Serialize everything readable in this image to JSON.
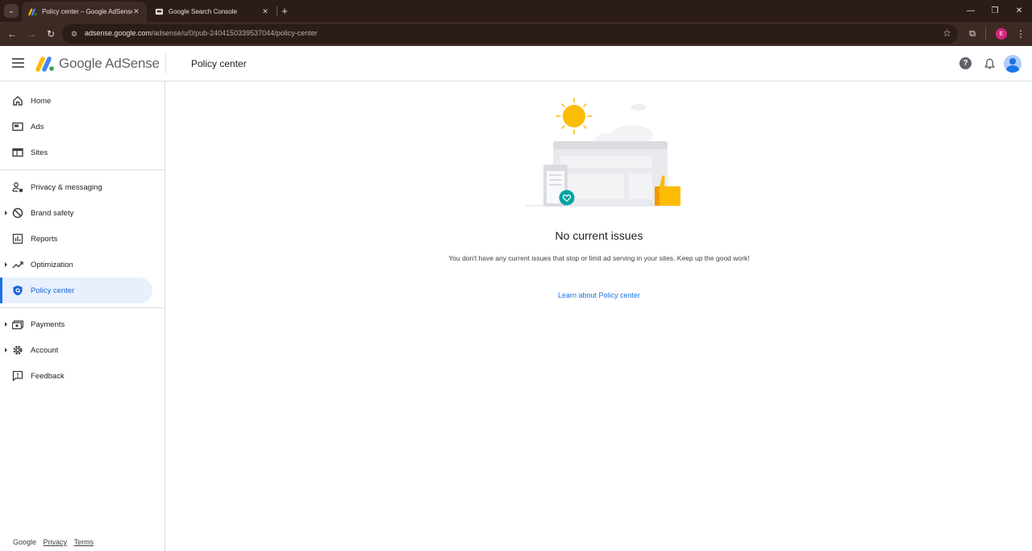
{
  "browser": {
    "tabs": [
      {
        "title": "Policy center – Google AdSense",
        "active": true,
        "favicon": "adsense-icon"
      },
      {
        "title": "Google Search Console",
        "active": false,
        "favicon": "search-console-icon"
      }
    ],
    "url_host": "adsense.google.com",
    "url_path": "/adsense/u/0/pub-2404150339537044/policy-center",
    "profile_initial": "E"
  },
  "header": {
    "brand": "Google AdSense",
    "page_title": "Policy center"
  },
  "sidebar": {
    "items": [
      {
        "label": "Home",
        "icon": "home-icon"
      },
      {
        "label": "Ads",
        "icon": "ads-icon"
      },
      {
        "label": "Sites",
        "icon": "sites-icon"
      },
      {
        "label": "Privacy & messaging",
        "icon": "privacy-icon"
      },
      {
        "label": "Brand safety",
        "icon": "block-icon"
      },
      {
        "label": "Reports",
        "icon": "reports-icon"
      },
      {
        "label": "Optimization",
        "icon": "trending-icon"
      },
      {
        "label": "Policy center",
        "icon": "policy-shield-icon",
        "active": true
      },
      {
        "label": "Payments",
        "icon": "payments-icon"
      },
      {
        "label": "Account",
        "icon": "gear-icon"
      },
      {
        "label": "Feedback",
        "icon": "feedback-icon"
      }
    ],
    "footer": {
      "google": "Google",
      "privacy": "Privacy",
      "terms": "Terms"
    }
  },
  "main": {
    "title": "No current issues",
    "description": "You don't have any current issues that stop or limit ad serving in your sites. Keep up the good work!",
    "link": "Learn about Policy center"
  },
  "colors": {
    "accent": "#1a73e8",
    "active_bg": "#e8f0fe",
    "chrome_dark": "#2b1c18",
    "chrome_toolbar": "#3e2a24"
  }
}
